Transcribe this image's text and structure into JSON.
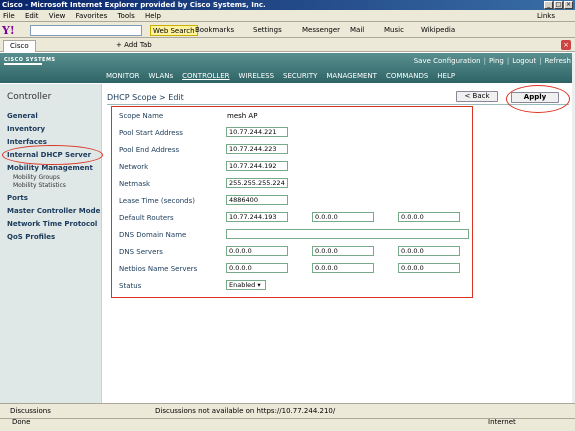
{
  "window": {
    "title": "Cisco - Microsoft Internet Explorer provided by Cisco Systems, Inc."
  },
  "menu": [
    "File",
    "Edit",
    "View",
    "Favorites",
    "Tools",
    "Help"
  ],
  "links_label": "Links",
  "toolbar": {
    "web_search": "Web Search",
    "bookmarks": "Bookmarks",
    "settings": "Settings",
    "messenger": "Messenger",
    "mail": "Mail",
    "music": "Music",
    "wikipedia": "Wikipedia"
  },
  "tabs": {
    "current": "Cisco",
    "add": "Add Tab"
  },
  "header": {
    "logo": "CISCO SYSTEMS",
    "links": [
      "Save Configuration",
      "Ping",
      "Logout",
      "Refresh"
    ],
    "nav": [
      "MONITOR",
      "WLANs",
      "CONTROLLER",
      "WIRELESS",
      "SECURITY",
      "MANAGEMENT",
      "COMMANDS",
      "HELP"
    ]
  },
  "sidebar": {
    "title": "Controller",
    "items": [
      "General",
      "Inventory",
      "Interfaces",
      "Internal DHCP Server",
      "Mobility Management",
      "Ports",
      "Master Controller Mode",
      "Network Time Protocol",
      "QoS Profiles"
    ],
    "subitems": [
      "Mobility Groups",
      "Mobility Statistics"
    ]
  },
  "page": {
    "title": "DHCP Scope > Edit",
    "back": "< Back",
    "apply": "Apply"
  },
  "form": {
    "scope_name_label": "Scope Name",
    "scope_name": "mesh AP",
    "pool_start_label": "Pool Start Address",
    "pool_start": "10.77.244.221",
    "pool_end_label": "Pool End Address",
    "pool_end": "10.77.244.223",
    "network_label": "Network",
    "network": "10.77.244.192",
    "netmask_label": "Netmask",
    "netmask": "255.255.255.224",
    "lease_label": "Lease Time (seconds)",
    "lease": "4886400",
    "routers_label": "Default Routers",
    "routers": [
      "10.77.244.193",
      "0.0.0.0",
      "0.0.0.0"
    ],
    "dns_domain_label": "DNS Domain Name",
    "dns_domain": "",
    "dns_servers_label": "DNS Servers",
    "dns_servers": [
      "0.0.0.0",
      "0.0.0.0",
      "0.0.0.0"
    ],
    "netbios_label": "Netbios Name Servers",
    "netbios": [
      "0.0.0.0",
      "0.0.0.0",
      "0.0.0.0"
    ],
    "status_label": "Status",
    "status": "Enabled"
  },
  "statusbar": {
    "discussions": "Discussions",
    "disc_msg": "Discussions not available on https://10.77.244.210/",
    "done": "Done",
    "zone": "Internet"
  }
}
